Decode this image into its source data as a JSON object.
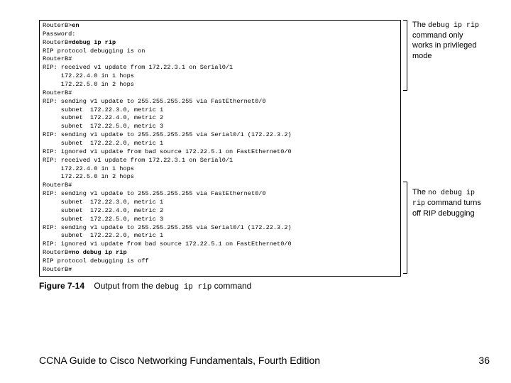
{
  "terminal": {
    "lines": [
      {
        "t": "RouterB>",
        "b": "en"
      },
      {
        "t": "Password:"
      },
      {
        "t": "RouterB#",
        "b": "debug ip rip"
      },
      {
        "t": "RIP protocol debugging is on"
      },
      {
        "t": "RouterB#"
      },
      {
        "t": "RIP: received v1 update from 172.22.3.1 on Serial0/1"
      },
      {
        "t": "     172.22.4.0 in 1 hops"
      },
      {
        "t": "     172.22.5.0 in 2 hops"
      },
      {
        "t": "RouterB#"
      },
      {
        "t": "RIP: sending v1 update to 255.255.255.255 via FastEthernet0/0"
      },
      {
        "t": "     subnet  172.22.3.0, metric 1"
      },
      {
        "t": "     subnet  172.22.4.0, metric 2"
      },
      {
        "t": "     subnet  172.22.5.0, metric 3"
      },
      {
        "t": "RIP: sending v1 update to 255.255.255.255 via Serial0/1 (172.22.3.2)"
      },
      {
        "t": "     subnet  172.22.2.0, metric 1"
      },
      {
        "t": "RIP: ignored v1 update from bad source 172.22.5.1 on FastEthernet0/0"
      },
      {
        "t": "RIP: received v1 update from 172.22.3.1 on Serial0/1"
      },
      {
        "t": "     172.22.4.0 in 1 hops"
      },
      {
        "t": "     172.22.5.0 in 2 hops"
      },
      {
        "t": "RouterB#"
      },
      {
        "t": "RIP: sending v1 update to 255.255.255.255 via FastEthernet0/0"
      },
      {
        "t": "     subnet  172.22.3.0, metric 1"
      },
      {
        "t": "     subnet  172.22.4.0, metric 2"
      },
      {
        "t": "     subnet  172.22.5.0, metric 3"
      },
      {
        "t": "RIP: sending v1 update to 255.255.255.255 via Serial0/1 (172.22.3.2)"
      },
      {
        "t": "     subnet  172.22.2.0, metric 1"
      },
      {
        "t": "RIP: ignored v1 update from bad source 172.22.5.1 on FastEthernet0/0"
      },
      {
        "t": "RouterB#",
        "b": "no debug ip rip"
      },
      {
        "t": "RIP protocol debugging is off"
      },
      {
        "t": "RouterB#"
      }
    ]
  },
  "annotations": {
    "top": {
      "pre": "The ",
      "mono": "debug ip rip",
      "post": " command only works in privileged mode"
    },
    "bottom": {
      "pre": "The ",
      "mono": "no debug ip rip",
      "post": " command turns off RIP debugging"
    }
  },
  "figure": {
    "number": "Figure 7-14",
    "caption_pre": "Output from the ",
    "caption_mono": "debug ip rip",
    "caption_post": " command"
  },
  "footer": {
    "title": "CCNA Guide to Cisco Networking Fundamentals, Fourth Edition",
    "page": "36"
  }
}
